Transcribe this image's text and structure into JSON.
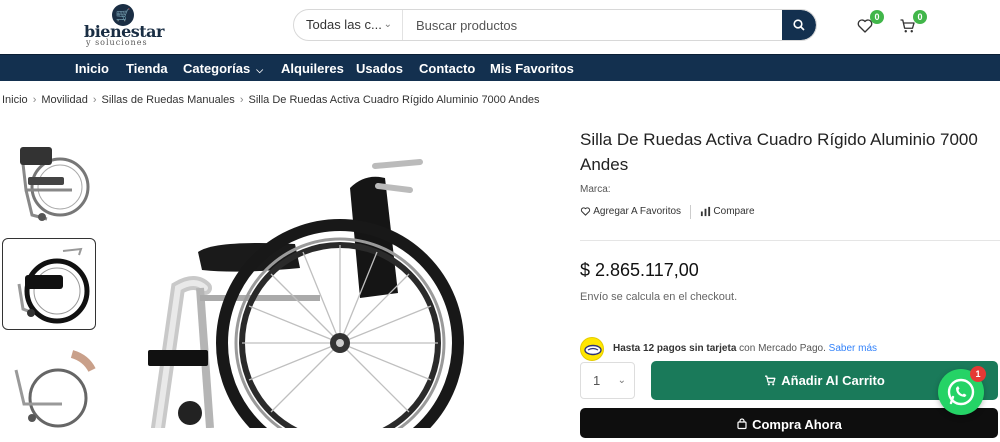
{
  "brand": {
    "name": "bienestar",
    "tagline": "y soluciones"
  },
  "search": {
    "category": "Todas las c...",
    "placeholder": "Buscar productos"
  },
  "header": {
    "wishlist_count": "0",
    "cart_count": "0"
  },
  "nav": {
    "items": [
      {
        "label": "Inicio"
      },
      {
        "label": "Tienda"
      },
      {
        "label": "Categorías"
      },
      {
        "label": "Alquileres"
      },
      {
        "label": "Usados"
      },
      {
        "label": "Contacto"
      },
      {
        "label": "Mis Favoritos"
      }
    ]
  },
  "breadcrumb": [
    "Inicio",
    "Movilidad",
    "Sillas de Ruedas Manuales",
    "Silla De Ruedas Activa Cuadro Rígido Aluminio 7000 Andes"
  ],
  "product": {
    "title": "Silla De Ruedas Activa Cuadro Rígido Aluminio 7000 Andes",
    "marca_label": "Marca:",
    "favorite_label": "Agregar A Favoritos",
    "compare_label": "Compare",
    "price": "$ 2.865.117,00",
    "shipping_note": "Envío se calcula en el checkout.",
    "quantity": "1",
    "add_to_cart": "Añadir Al Carrito",
    "buy_now": "Compra Ahora"
  },
  "mercadopago": {
    "highlight": "Hasta 12 pagos sin tarjeta",
    "text": "con Mercado Pago.",
    "link": "Saber más"
  },
  "whatsapp": {
    "badge": "1"
  },
  "colors": {
    "navy": "#13304f",
    "green_badge": "#41b64a",
    "cart_button": "#1a7a5a",
    "buy_button": "#0e0e0e",
    "whatsapp": "#25d366"
  }
}
